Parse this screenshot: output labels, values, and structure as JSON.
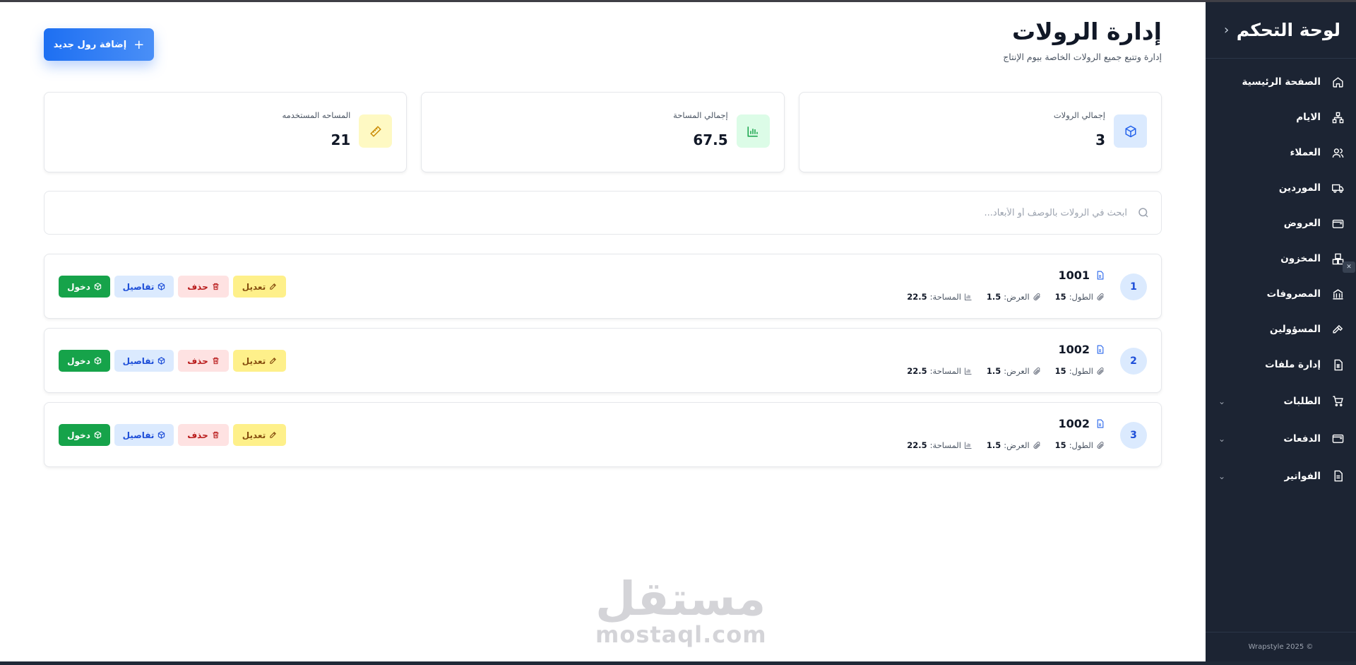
{
  "sidebar": {
    "title": "لوحة التحكم",
    "collapse_icon": "chevron-left-icon",
    "items": [
      {
        "label": "الصفحة الرئيسية",
        "icon": "home-icon"
      },
      {
        "label": "الايام",
        "icon": "network-icon"
      },
      {
        "label": "العملاء",
        "icon": "users-icon"
      },
      {
        "label": "الموردين",
        "icon": "truck-icon"
      },
      {
        "label": "العروض",
        "icon": "wallet-icon"
      },
      {
        "label": "المخزون",
        "icon": "boxes-icon"
      },
      {
        "label": "المصروفات",
        "icon": "bank-icon"
      },
      {
        "label": "المسؤولين",
        "icon": "hammer-icon"
      },
      {
        "label": "إدارة ملفات",
        "icon": "spreadsheet-icon"
      },
      {
        "label": "الطلبات",
        "icon": "cart-icon",
        "expandable": true
      },
      {
        "label": "الدفعات",
        "icon": "wallet-icon",
        "expandable": true
      },
      {
        "label": "الفواتير",
        "icon": "file-text-icon",
        "expandable": true
      }
    ],
    "footer": "Wrapstyle 2025 ©"
  },
  "header": {
    "title": "إدارة الرولات",
    "subtitle": "إدارة وتتبع جميع الرولات الخاصة بيوم الإنتاج",
    "add_button": "إضافة رول جديد"
  },
  "stats": [
    {
      "label": "إجمالي الرولات",
      "value": "3",
      "icon": "box-icon",
      "color": "#dbeafe"
    },
    {
      "label": "إجمالي المساحة",
      "value": "67.5",
      "icon": "bar-chart-icon",
      "color": "#dcfce7"
    },
    {
      "label": "المساحه المستخدمه",
      "value": "21",
      "icon": "ruler-icon",
      "color": "#fef9c3"
    }
  ],
  "search": {
    "placeholder": "ابحث في الرولات بالوصف أو الأبعاد..."
  },
  "labels": {
    "length": "الطول:",
    "width": "العرض:",
    "area": "المساحة:",
    "edit": "تعديل",
    "delete": "حذف",
    "details": "تفاصيل",
    "enter": "دخول"
  },
  "rolls": [
    {
      "index": "1",
      "title": "1001",
      "length": "15",
      "width": "1.5",
      "area": "22.5"
    },
    {
      "index": "2",
      "title": "1002",
      "length": "15",
      "width": "1.5",
      "area": "22.5"
    },
    {
      "index": "3",
      "title": "1002",
      "length": "15",
      "width": "1.5",
      "area": "22.5"
    }
  ],
  "watermark": {
    "arabic": "مستقل",
    "latin": "mostaql.com"
  },
  "colors": {
    "sidebar_bg": "#1c2433",
    "primary": "#1d6ff2",
    "success": "#16a34a"
  }
}
